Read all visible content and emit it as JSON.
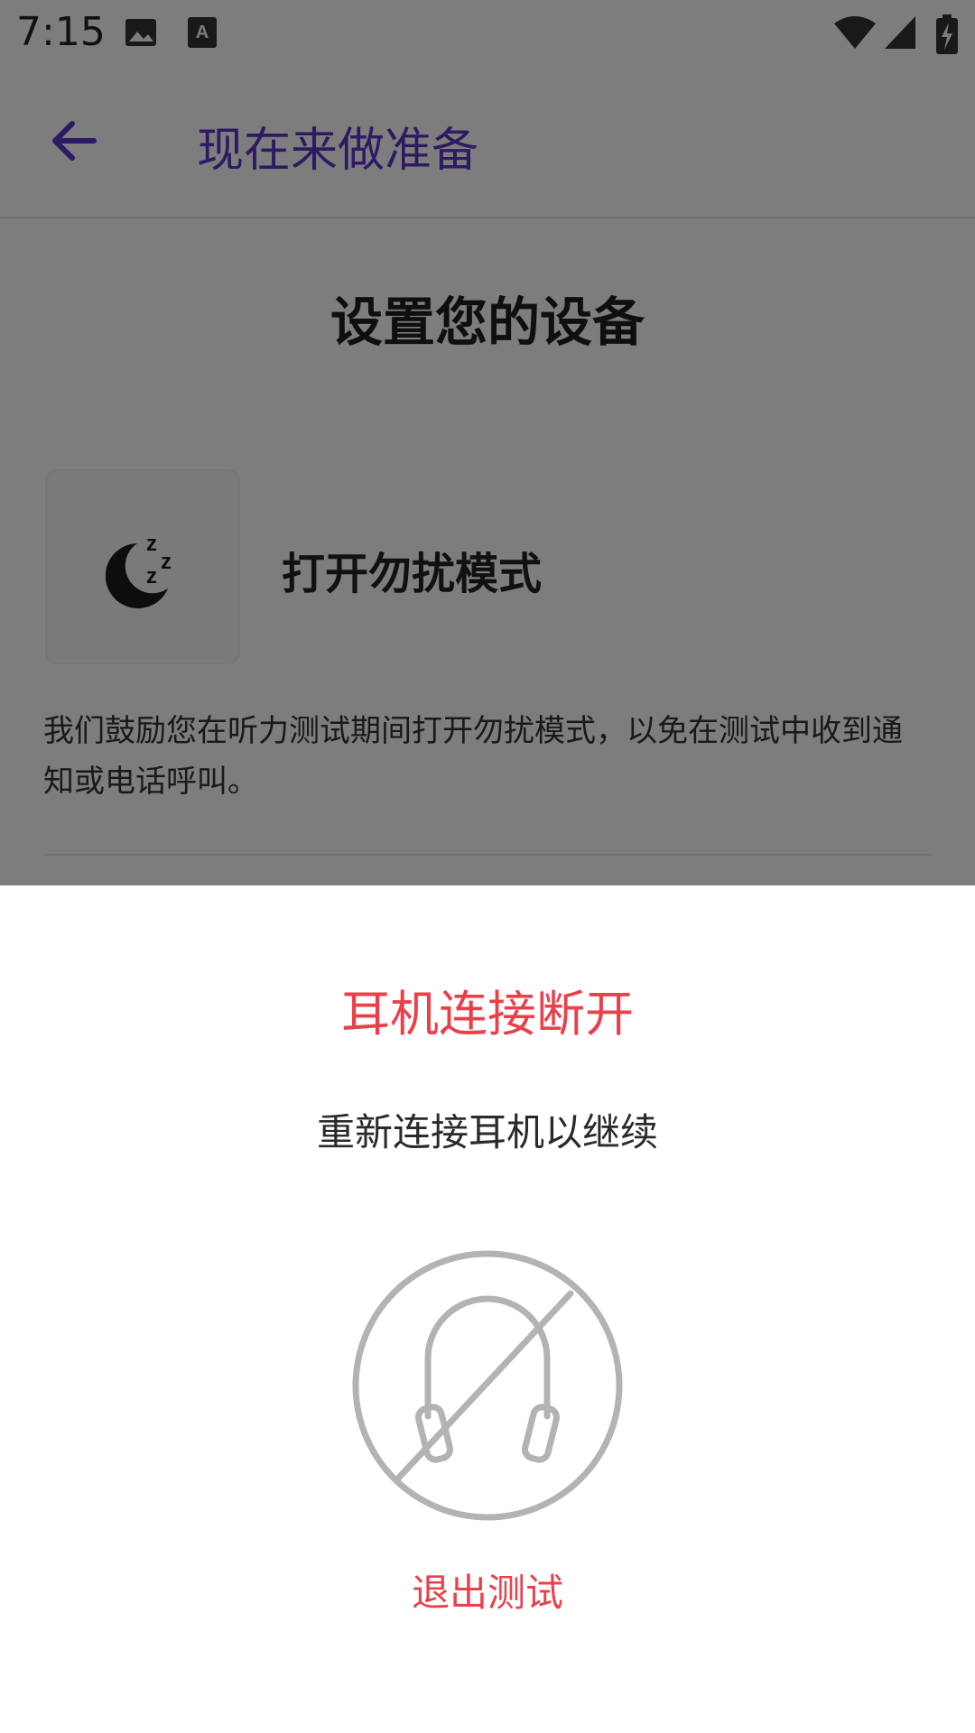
{
  "status_bar": {
    "time": "7:15",
    "icons": [
      "image-icon",
      "keyboard-a-icon",
      "wifi-icon",
      "signal-icon",
      "battery-charging-icon"
    ]
  },
  "app_bar": {
    "title": "现在来做准备",
    "back_icon": "back-arrow-icon",
    "accent_color": "#5c35c9"
  },
  "content": {
    "section_title": "设置您的设备",
    "dnd": {
      "icon": "moon-sleep-icon",
      "label": "打开勿扰模式",
      "description": "我们鼓励您在听力测试期间打开勿扰模式，以免在测试中收到通知或电话呼叫。"
    }
  },
  "sheet": {
    "title": "耳机连接断开",
    "message": "重新连接耳机以继续",
    "icon": "headphones-disconnected-icon",
    "exit_label": "退出测试",
    "alert_color": "#e8414b"
  }
}
